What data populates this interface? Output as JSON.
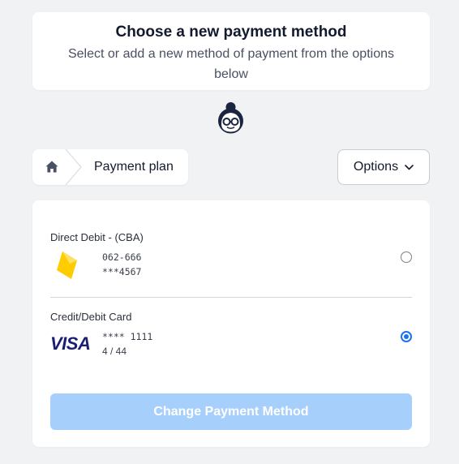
{
  "header": {
    "title": "Choose a new payment method",
    "subtitle": "Select or add a new method of payment from the options below"
  },
  "mascot_icon": "assistant-avatar-icon",
  "breadcrumb": {
    "home_icon": "home-icon",
    "current": "Payment plan"
  },
  "options": {
    "label": "Options",
    "icon": "chevron-down-icon"
  },
  "methods": [
    {
      "title": "Direct Debit - (CBA)",
      "icon": "cba-logo-icon",
      "line1": "062-666",
      "line2": "***4567",
      "selected": false
    },
    {
      "title": "Credit/Debit Card",
      "icon": "visa-logo-icon",
      "brand": "VISA",
      "line1": "**** 1111",
      "line2": "4 / 44",
      "selected": true
    }
  ],
  "submit": {
    "label": "Change Payment Method",
    "disabled": true
  },
  "colors": {
    "accent": "#1a73e8",
    "button_disabled": "#a6cffb",
    "cba_yellow": "#ffcc00",
    "visa_navy": "#1a1f71",
    "background": "#f1f2f4"
  }
}
